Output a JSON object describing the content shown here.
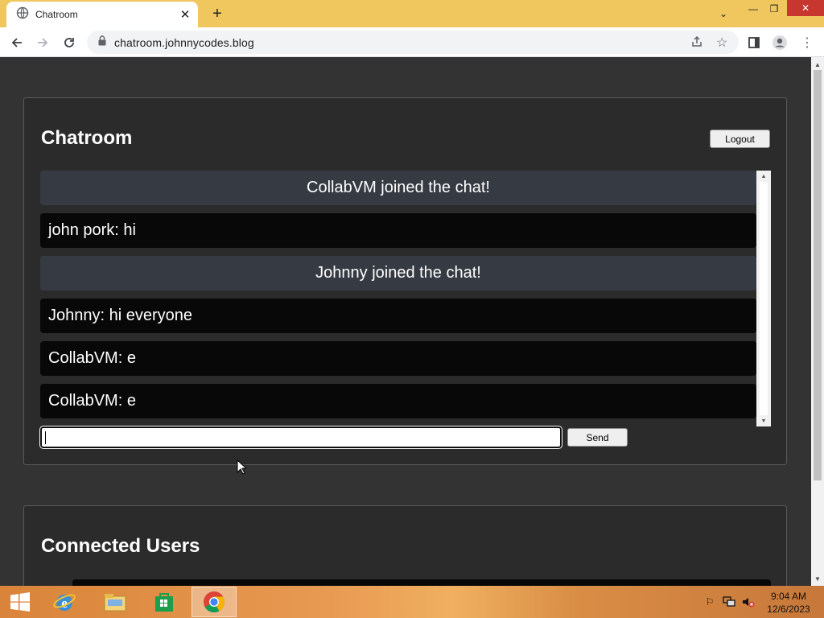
{
  "browser": {
    "tab_title": "Chatroom",
    "url": "chatroom.johnnycodes.blog"
  },
  "chat": {
    "title": "Chatroom",
    "logout_label": "Logout",
    "send_label": "Send",
    "input_value": "",
    "messages": [
      {
        "type": "system",
        "text": "CollabVM joined the chat!"
      },
      {
        "type": "user",
        "text": "john pork: hi"
      },
      {
        "type": "system",
        "text": "Johnny joined the chat!"
      },
      {
        "type": "user",
        "text": "Johnny: hi everyone"
      },
      {
        "type": "user",
        "text": "CollabVM: e"
      },
      {
        "type": "user",
        "text": "CollabVM: e"
      }
    ]
  },
  "users": {
    "title": "Connected Users"
  },
  "taskbar": {
    "time": "9:04 AM",
    "date": "12/6/2023"
  }
}
